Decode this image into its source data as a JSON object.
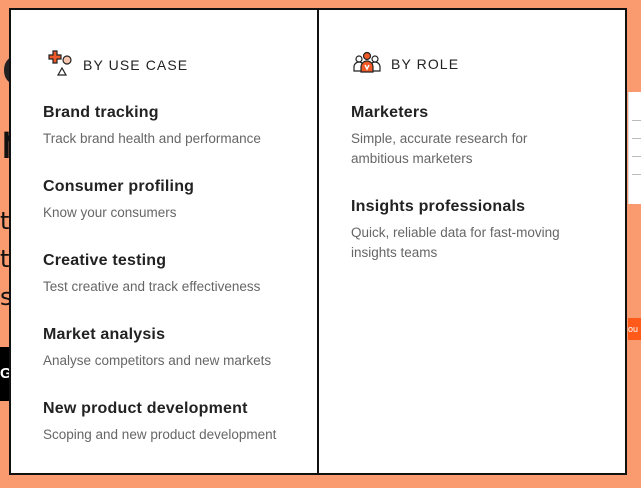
{
  "background": {
    "fragment_c": "C",
    "fragment_n": "n",
    "fragment_t1": "th",
    "fragment_t2": "t",
    "fragment_t3": "s",
    "button_label": "Ge",
    "orange_label": "ou"
  },
  "menu": {
    "by_use_case": {
      "heading": "BY USE CASE",
      "icon": "use-case-shapes-icon",
      "items": [
        {
          "title": "Brand tracking",
          "desc": "Track brand health and performance"
        },
        {
          "title": "Consumer profiling",
          "desc": "Know your consumers"
        },
        {
          "title": "Creative testing",
          "desc": "Test creative and track effectiveness"
        },
        {
          "title": "Market analysis",
          "desc": "Analyse competitors and new markets"
        },
        {
          "title": "New product development",
          "desc": "Scoping and new product development"
        }
      ]
    },
    "by_role": {
      "heading": "BY ROLE",
      "icon": "people-group-icon",
      "items": [
        {
          "title": "Marketers",
          "desc": "Simple, accurate research for ambitious marketers"
        },
        {
          "title": "Insights professionals",
          "desc": "Quick, reliable data for fast-moving insights teams"
        }
      ]
    }
  },
  "colors": {
    "background": "#f99a6f",
    "accent": "#f05a28",
    "border": "#111111"
  }
}
